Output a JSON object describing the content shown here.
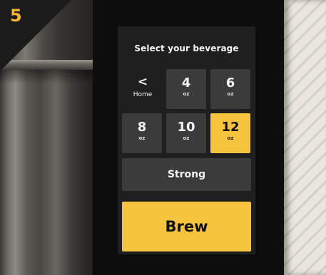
{
  "step": {
    "number": "5"
  },
  "screen": {
    "title": "Select your beverage",
    "home_label": "Home",
    "home_chevron": "<",
    "unit_label": "oz",
    "sizes": [
      {
        "value": "4",
        "selected": false
      },
      {
        "value": "6",
        "selected": false
      },
      {
        "value": "8",
        "selected": false
      },
      {
        "value": "10",
        "selected": false
      },
      {
        "value": "12",
        "selected": true
      }
    ],
    "strong_label": "Strong",
    "brew_label": "Brew"
  },
  "colors": {
    "accent": "#f6c33e",
    "step_number": "#f4b534",
    "button_dark": "#3b3b3b",
    "screen_bg": "#1f1f1f"
  }
}
